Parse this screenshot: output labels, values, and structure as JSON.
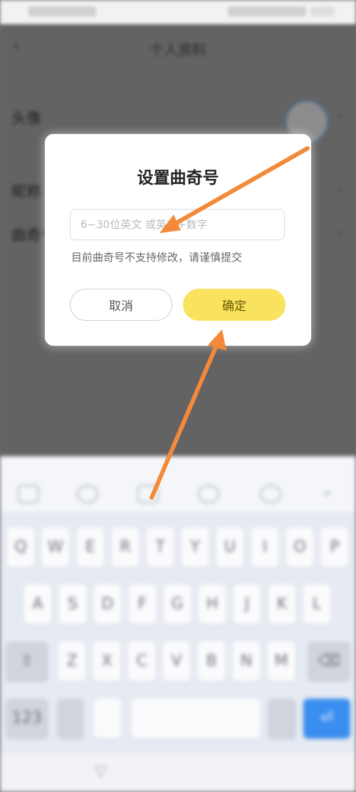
{
  "background_app": {
    "page_title": "个人资料",
    "rows": {
      "avatar_label": "头像",
      "nickname_label": "昵称",
      "qq_label": "曲奇号"
    }
  },
  "dialog": {
    "title": "设置曲奇号",
    "input_placeholder": "6~30位英文 或英文+数字",
    "input_value": "",
    "hint": "目前曲奇号不支持修改，请谨慎提交",
    "cancel_label": "取消",
    "confirm_label": "确定"
  },
  "keyboard": {
    "row1": [
      "Q",
      "W",
      "E",
      "R",
      "T",
      "Y",
      "U",
      "I",
      "O",
      "P"
    ],
    "row2": [
      "A",
      "S",
      "D",
      "F",
      "G",
      "H",
      "J",
      "K",
      "L"
    ],
    "row3": [
      "Z",
      "X",
      "C",
      "V",
      "B",
      "N",
      "M"
    ],
    "shift": "⇧",
    "backspace": "⌫",
    "numbers": "123",
    "enter": "⏎"
  },
  "colors": {
    "confirm_bg": "#f9e35e",
    "annotation_arrow": "#f28a3a",
    "overlay": "#636363"
  },
  "icons": {
    "back": "back-arrow-icon",
    "chevron": "chevron-right-icon",
    "keyboard_hide": "chevron-down-icon",
    "nav": "nav-down-icon"
  }
}
